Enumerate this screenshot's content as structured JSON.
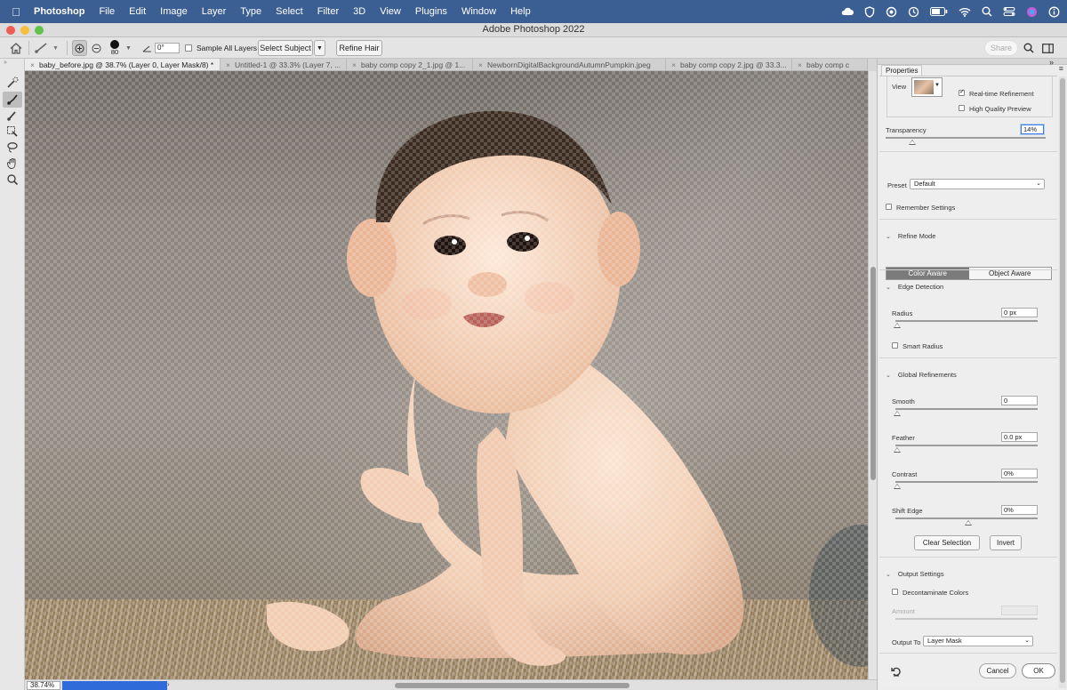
{
  "menubar": {
    "app_name": "Photoshop",
    "items": [
      "File",
      "Edit",
      "Image",
      "Layer",
      "Type",
      "Select",
      "Filter",
      "3D",
      "View",
      "Plugins",
      "Window",
      "Help"
    ]
  },
  "window": {
    "title": "Adobe Photoshop 2022"
  },
  "options": {
    "brush_size": "80",
    "angle": "0°",
    "sample_all_layers": "Sample All Layers",
    "select_subject": "Select Subject",
    "refine_hair": "Refine Hair",
    "share": "Share"
  },
  "tabs": [
    {
      "label": "baby_before.jpg @ 38.7% (Layer 0, Layer Mask/8) *"
    },
    {
      "label": "Untitled-1 @ 33.3% (Layer 7, ..."
    },
    {
      "label": "baby comp copy 2_1.jpg @ 1..."
    },
    {
      "label": "NewbornDigitalBackgroundAutumnPumpkin.jpeg"
    },
    {
      "label": "baby comp copy 2.jpg @ 33.3..."
    },
    {
      "label": "baby comp c"
    }
  ],
  "status": {
    "zoom": "38.74%",
    "progress_fraction": 1.0
  },
  "panel": {
    "tab": "Properties",
    "view_label": "View",
    "realtime": "Real-time Refinement",
    "high_quality": "High Quality Preview",
    "transparency_label": "Transparency",
    "transparency_value": "14%",
    "preset_label": "Preset",
    "preset_value": "Default",
    "remember": "Remember Settings",
    "refine_mode": "Refine Mode",
    "color_aware": "Color Aware",
    "object_aware": "Object Aware",
    "edge_detection": "Edge Detection",
    "radius_label": "Radius",
    "radius_value": "0 px",
    "smart_radius": "Smart Radius",
    "global_refinements": "Global Refinements",
    "smooth_label": "Smooth",
    "smooth_value": "0",
    "feather_label": "Feather",
    "feather_value": "0.0 px",
    "contrast_label": "Contrast",
    "contrast_value": "0%",
    "shift_label": "Shift Edge",
    "shift_value": "0%",
    "clear_selection": "Clear Selection",
    "invert": "Invert",
    "output_settings": "Output Settings",
    "decontaminate": "Decontaminate Colors",
    "amount_label": "Amount",
    "output_to_label": "Output To",
    "output_to_value": "Layer Mask",
    "cancel": "Cancel",
    "ok": "OK"
  }
}
